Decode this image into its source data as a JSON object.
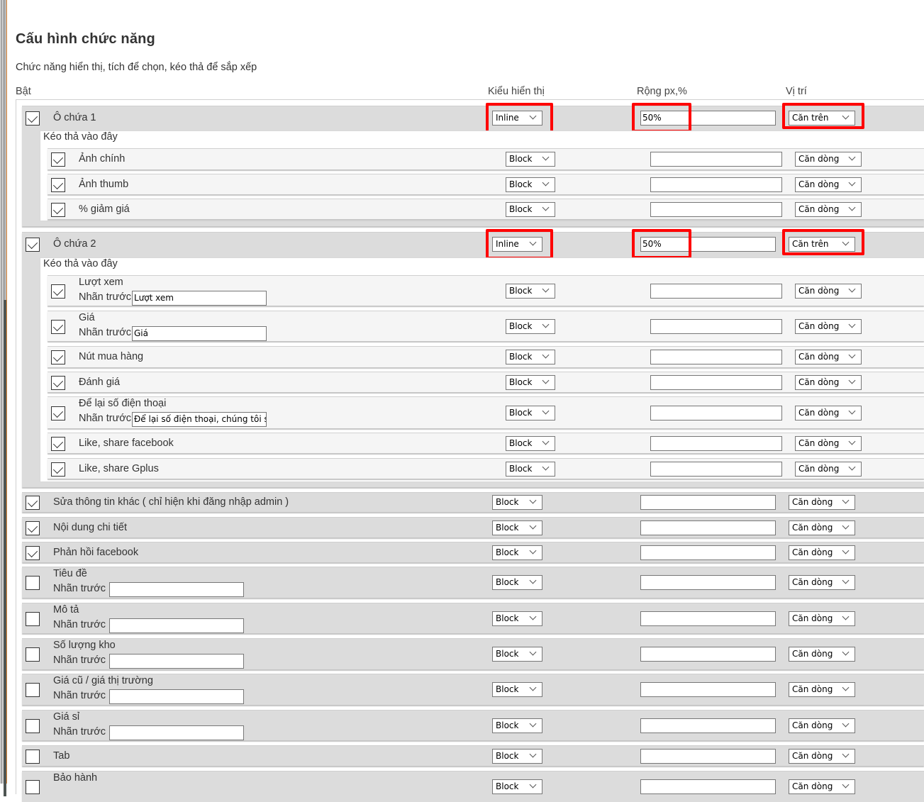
{
  "page": {
    "title": "Cấu hình chức năng",
    "subtitle": "Chức năng hiển thị, tích để chọn, kéo thả để sắp xếp",
    "columns": {
      "enable": "Bật",
      "display_type": "Kiểu hiển thị",
      "width": "Rộng px,%",
      "position": "Vị trí"
    },
    "prefix_label": "Nhãn trước",
    "drop_zone_label": "Kéo thả vào đây"
  },
  "containers": [
    {
      "label": "Ô chứa 1",
      "checked": true,
      "display_type": "Inline",
      "width": "50%",
      "position": "Căn trên",
      "highlighted": true,
      "children": [
        {
          "label": "Ảnh chính",
          "checked": true,
          "display_type": "Block",
          "width": "",
          "position": "Căn dòng"
        },
        {
          "label": "Ảnh thumb",
          "checked": true,
          "display_type": "Block",
          "width": "",
          "position": "Căn dòng"
        },
        {
          "label": "% giảm giá",
          "checked": true,
          "display_type": "Block",
          "width": "",
          "position": "Căn dòng"
        }
      ]
    },
    {
      "label": "Ô chứa 2",
      "checked": true,
      "display_type": "Inline",
      "width": "50%",
      "position": "Căn trên",
      "highlighted": true,
      "children": [
        {
          "label": "Lượt xem",
          "checked": true,
          "prefix": "Lượt xem",
          "display_type": "Block",
          "width": "",
          "position": "Căn dòng"
        },
        {
          "label": "Giá",
          "checked": true,
          "prefix": "Giá",
          "display_type": "Block",
          "width": "",
          "position": "Căn dòng"
        },
        {
          "label": "Nút mua hàng",
          "checked": true,
          "display_type": "Block",
          "width": "",
          "position": "Căn dòng"
        },
        {
          "label": "Đánh giá",
          "checked": true,
          "display_type": "Block",
          "width": "",
          "position": "Căn dòng"
        },
        {
          "label": "Để lại số điện thoại",
          "checked": true,
          "prefix": "Để lại số điện thoại, chúng tôi sẽ ",
          "display_type": "Block",
          "width": "",
          "position": "Căn dòng"
        },
        {
          "label": "Like, share facebook",
          "checked": true,
          "display_type": "Block",
          "width": "",
          "position": "Căn dòng"
        },
        {
          "label": "Like, share Gplus",
          "checked": true,
          "display_type": "Block",
          "width": "",
          "position": "Căn dòng"
        }
      ]
    }
  ],
  "items": [
    {
      "label": "Sửa thông tin khác ( chỉ hiện khi đăng nhập admin )",
      "checked": true,
      "display_type": "Block",
      "width": "",
      "position": "Căn dòng"
    },
    {
      "label": "Nội dung chi tiết",
      "checked": true,
      "display_type": "Block",
      "width": "",
      "position": "Căn dòng"
    },
    {
      "label": "Phản hồi facebook",
      "checked": true,
      "display_type": "Block",
      "width": "",
      "position": "Căn dòng"
    },
    {
      "label": "Tiêu đề",
      "checked": false,
      "prefix": "",
      "display_type": "Block",
      "width": "",
      "position": "Căn dòng"
    },
    {
      "label": "Mô tả",
      "checked": false,
      "prefix": "",
      "display_type": "Block",
      "width": "",
      "position": "Căn dòng"
    },
    {
      "label": "Số lượng kho",
      "checked": false,
      "prefix": "",
      "display_type": "Block",
      "width": "",
      "position": "Căn dòng"
    },
    {
      "label": "Giá cũ / giá thị trường",
      "checked": false,
      "prefix": "",
      "display_type": "Block",
      "width": "",
      "position": "Căn dòng"
    },
    {
      "label": "Giá sỉ",
      "checked": false,
      "prefix": "",
      "display_type": "Block",
      "width": "",
      "position": "Căn dòng"
    },
    {
      "label": "Tab",
      "checked": false,
      "display_type": "Block",
      "width": "",
      "position": "Căn dòng"
    },
    {
      "label": "Bảo hành",
      "checked": false,
      "display_type": "Block",
      "width": "",
      "position": "Căn dòng"
    }
  ],
  "colors": {
    "highlight": "#ff0000",
    "row_bg": "#dcdcdc",
    "sub_row_bg": "#f5f5f5",
    "scrollbar_accent": "#e08a3c"
  }
}
